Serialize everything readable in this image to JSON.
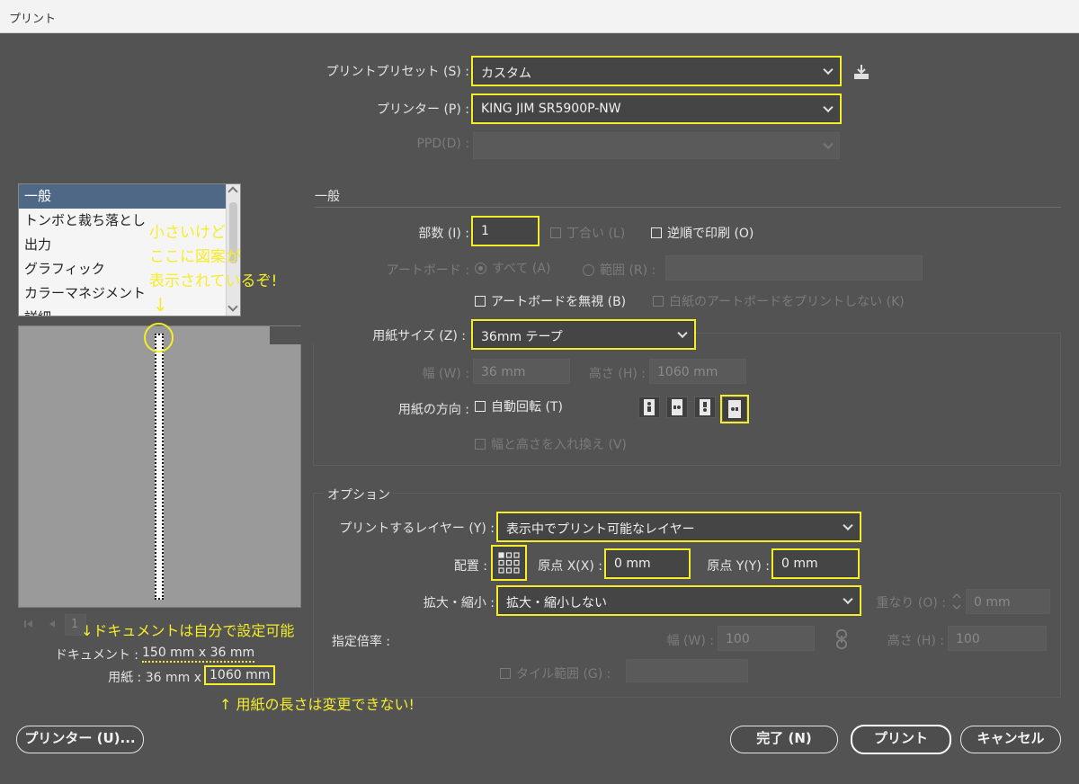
{
  "window": {
    "title": "プリント"
  },
  "preset": {
    "label": "プリントプリセット (S) :",
    "value": "カスタム"
  },
  "printer": {
    "label": "プリンター (P) :",
    "value": "KING JIM SR5900P-NW"
  },
  "ppd": {
    "label": "PPD(D) :",
    "value": ""
  },
  "sidebar": {
    "items": [
      {
        "label": "一般"
      },
      {
        "label": "トンボと裁ち落とし"
      },
      {
        "label": "出力"
      },
      {
        "label": "グラフィック"
      },
      {
        "label": "カラーマネジメント"
      },
      {
        "label": "詳細"
      }
    ]
  },
  "general": {
    "heading": "一般",
    "copies_label": "部数 (I) :",
    "copies_value": "1",
    "collate_label": "丁合い (L)",
    "reverse_label": "逆順で印刷 (O)",
    "artboard_label": "アートボード :",
    "all_label": "すべて (A)",
    "range_label": "範囲 (R) :",
    "range_value": "",
    "ignore_artboards_label": "アートボードを無視 (B)",
    "skip_blank_label": "白紙のアートボードをプリントしない (K)"
  },
  "paper": {
    "size_label": "用紙サイズ (Z) :",
    "size_value": "36mm テープ",
    "width_label": "幅 (W) :",
    "width_value": "36 mm",
    "height_label": "高さ (H) :",
    "height_value": "1060 mm",
    "orientation_label": "用紙の方向 :",
    "auto_rotate_label": "自動回転 (T)",
    "swap_label": "幅と高さを入れ換え (V)"
  },
  "options": {
    "heading": "オプション",
    "layers_label": "プリントするレイヤー (Y) :",
    "layers_value": "表示中でプリント可能なレイヤー",
    "placement_label": "配置 :",
    "origin_x_label": "原点 X(X) :",
    "origin_x_value": "0 mm",
    "origin_y_label": "原点 Y(Y) :",
    "origin_y_value": "0 mm",
    "scale_label": "拡大・縮小 :",
    "scale_value": "拡大・縮小しない",
    "overlap_label": "重なり (O) :",
    "overlap_value": "0 mm",
    "custom_scale_label": "指定倍率 :",
    "scale_w_label": "幅 (W) :",
    "scale_w_value": "100",
    "scale_h_label": "高さ (H) :",
    "scale_h_value": "100",
    "tile_label": "タイル範囲 (G) :",
    "tile_value": ""
  },
  "preview": {
    "page_value": "1",
    "document_label": "ドキュメント :",
    "document_value": "150 mm x 36 mm",
    "paper_label": "用紙 : 36 mm x",
    "paper_value": "1060 mm"
  },
  "annotations": {
    "note1_line1": "小さいけど",
    "note1_line2": "ここに図案が",
    "note1_line3": "表示されているぞ!",
    "arrow_down": "↓",
    "note2": "↓ドキュメントは自分で設定可能",
    "note3": "↑ 用紙の長さは変更できない!"
  },
  "buttons": {
    "printer": "プリンター (U)...",
    "done": "完了 (N)",
    "print": "プリント",
    "cancel": "キャンセル"
  },
  "colors": {
    "background": "#535353",
    "highlight": "#f5ec2a",
    "selected": "#4e6885"
  }
}
